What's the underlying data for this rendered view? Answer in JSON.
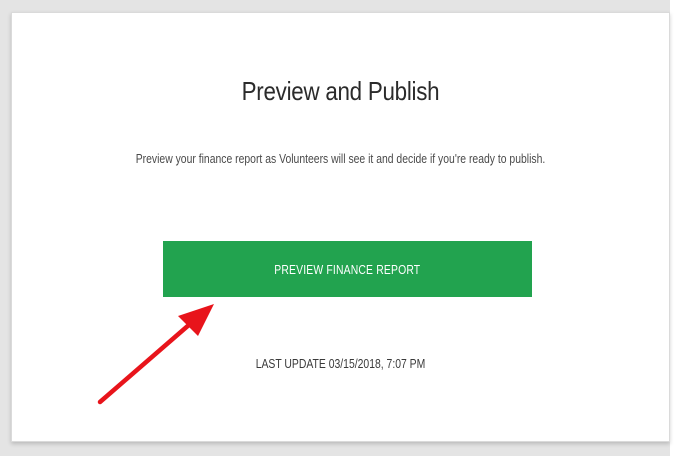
{
  "page": {
    "title": "Preview and Publish",
    "description": "Preview your finance report as Volunteers will see it and decide if you're ready to publish.",
    "preview_button_label": "PREVIEW FINANCE REPORT",
    "last_update": "LAST UPDATE 03/15/2018, 7:07 PM"
  },
  "colors": {
    "button_green": "#22a34f",
    "annotation_arrow": "#e8141b"
  },
  "annotation": {
    "arrow_icon": "arrow-annotation-icon",
    "points_to": "preview-finance-report-button"
  }
}
